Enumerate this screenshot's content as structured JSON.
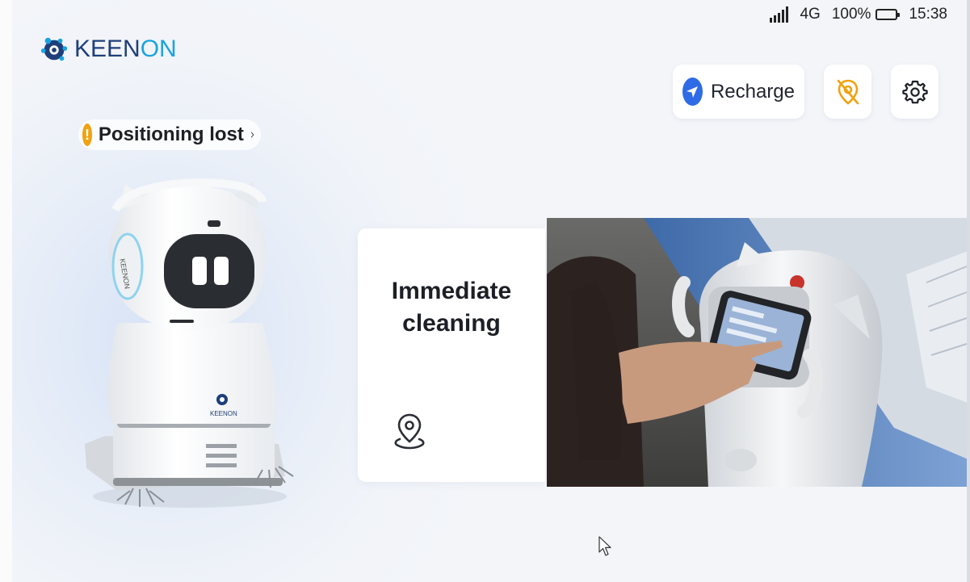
{
  "status_bar": {
    "network": "4G",
    "battery": "100%",
    "time": "15:38"
  },
  "brand": {
    "name_a": "KEEN",
    "name_b": "ON",
    "color_dark": "#1e3f7a",
    "color_light": "#1aa3e0"
  },
  "toolbar": {
    "recharge_label": "Recharge",
    "recharge_icon": "navigation-arrow-icon",
    "location_icon": "location-off-icon",
    "settings_icon": "gear-icon"
  },
  "positioning": {
    "label": "Positioning lost",
    "icon": "warning-icon",
    "warning_color": "#f0a20f"
  },
  "robot_image": {
    "logo_text": "KEENON"
  },
  "card": {
    "title": "Immediate\ncleaning",
    "icon": "map-pin-icon"
  },
  "colors": {
    "accent": "#2e6be6"
  }
}
